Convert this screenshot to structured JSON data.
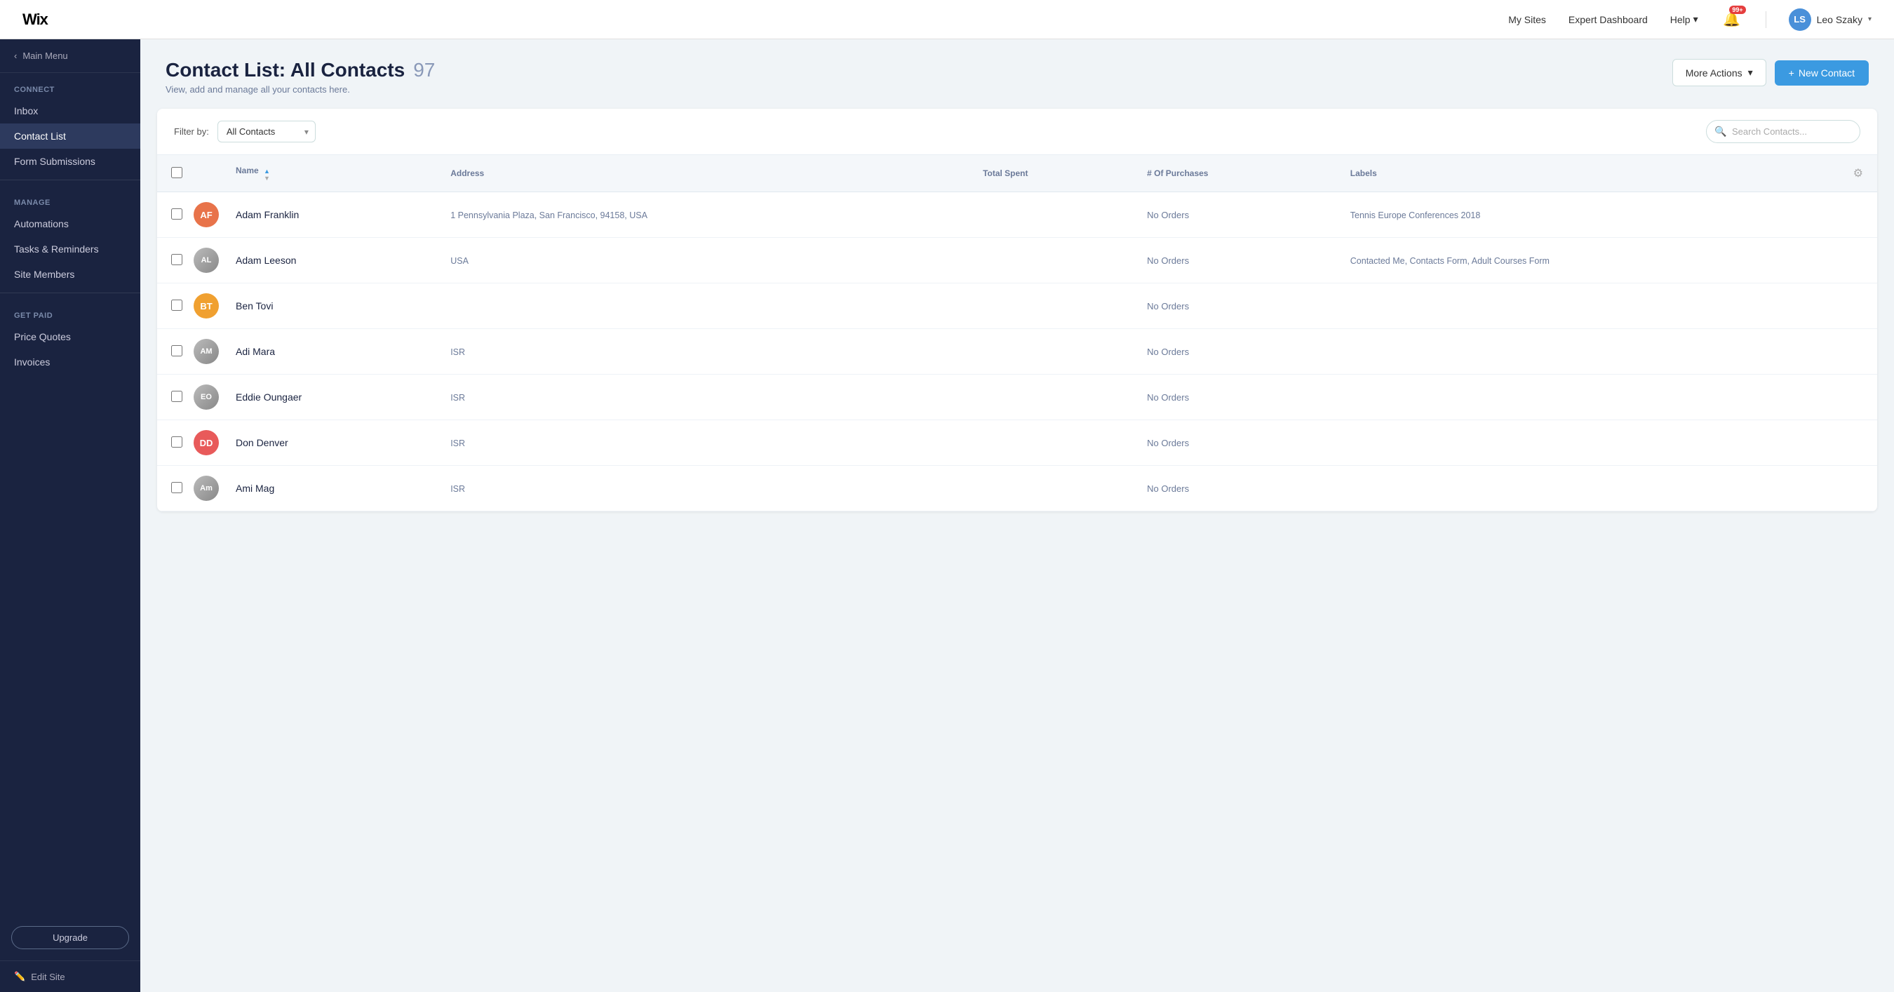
{
  "topNav": {
    "logoText": "Wix",
    "mySites": "My Sites",
    "expertDashboard": "Expert Dashboard",
    "help": "Help",
    "notifBadge": "99+",
    "userName": "Leo Szaky",
    "userInitials": "LS"
  },
  "sidebar": {
    "backLabel": "Main Menu",
    "sections": [
      {
        "label": "Connect",
        "items": [
          {
            "id": "inbox",
            "label": "Inbox",
            "active": false
          },
          {
            "id": "contact-list",
            "label": "Contact List",
            "active": true
          },
          {
            "id": "form-submissions",
            "label": "Form Submissions",
            "active": false
          }
        ]
      },
      {
        "label": "Manage",
        "items": [
          {
            "id": "automations",
            "label": "Automations",
            "active": false
          },
          {
            "id": "tasks-reminders",
            "label": "Tasks & Reminders",
            "active": false
          },
          {
            "id": "site-members",
            "label": "Site Members",
            "active": false
          }
        ]
      },
      {
        "label": "Get Paid",
        "items": [
          {
            "id": "price-quotes",
            "label": "Price Quotes",
            "active": false
          },
          {
            "id": "invoices",
            "label": "Invoices",
            "active": false
          }
        ]
      }
    ],
    "upgradeLabel": "Upgrade",
    "editSiteLabel": "Edit Site"
  },
  "pageHeader": {
    "title": "Contact List: All Contacts",
    "count": "97",
    "subtitle": "View, add and manage all your contacts here.",
    "moreActionsLabel": "More Actions",
    "newContactLabel": "New Contact"
  },
  "filterBar": {
    "filterByLabel": "Filter by:",
    "filterOption": "All Contacts",
    "searchPlaceholder": "Search Contacts..."
  },
  "table": {
    "columns": [
      {
        "id": "name",
        "label": "Name",
        "sortable": true
      },
      {
        "id": "address",
        "label": "Address",
        "sortable": false
      },
      {
        "id": "total-spent",
        "label": "Total Spent",
        "sortable": false
      },
      {
        "id": "num-purchases",
        "label": "# Of Purchases",
        "sortable": false
      },
      {
        "id": "labels",
        "label": "Labels",
        "sortable": false
      }
    ],
    "rows": [
      {
        "id": "adam-franklin",
        "initials": "AF",
        "avatarColor": "#e8734a",
        "hasPhoto": false,
        "name": "Adam Franklin",
        "address": "1 Pennsylvania Plaza, San Francisco, 94158, USA",
        "totalSpent": "",
        "numPurchases": "No Orders",
        "labels": "Tennis Europe Conferences 2018"
      },
      {
        "id": "adam-leeson",
        "initials": "AL",
        "avatarColor": "#7a8898",
        "hasPhoto": true,
        "photoUrl": "",
        "name": "Adam Leeson",
        "address": "USA",
        "totalSpent": "",
        "numPurchases": "No Orders",
        "labels": "Contacted Me, Contacts Form, Adult Courses Form"
      },
      {
        "id": "ben-tovi",
        "initials": "BT",
        "avatarColor": "#f0a030",
        "hasPhoto": false,
        "name": "Ben Tovi",
        "address": "",
        "totalSpent": "",
        "numPurchases": "No Orders",
        "labels": ""
      },
      {
        "id": "adi-mara",
        "initials": "AM",
        "avatarColor": "#888",
        "hasPhoto": true,
        "photoUrl": "",
        "name": "Adi Mara",
        "address": "ISR",
        "totalSpent": "",
        "numPurchases": "No Orders",
        "labels": ""
      },
      {
        "id": "eddie-oungaer",
        "initials": "EO",
        "avatarColor": "#7a5a48",
        "hasPhoto": true,
        "photoUrl": "",
        "name": "Eddie Oungaer",
        "address": "ISR",
        "totalSpent": "",
        "numPurchases": "No Orders",
        "labels": ""
      },
      {
        "id": "don-denver",
        "initials": "DD",
        "avatarColor": "#e85a5a",
        "hasPhoto": false,
        "name": "Don Denver",
        "address": "ISR",
        "totalSpent": "",
        "numPurchases": "No Orders",
        "labels": ""
      },
      {
        "id": "ami-mag",
        "initials": "Am",
        "avatarColor": "#888",
        "hasPhoto": true,
        "photoUrl": "",
        "name": "Ami Mag",
        "address": "ISR",
        "totalSpent": "",
        "numPurchases": "No Orders",
        "labels": ""
      }
    ]
  }
}
